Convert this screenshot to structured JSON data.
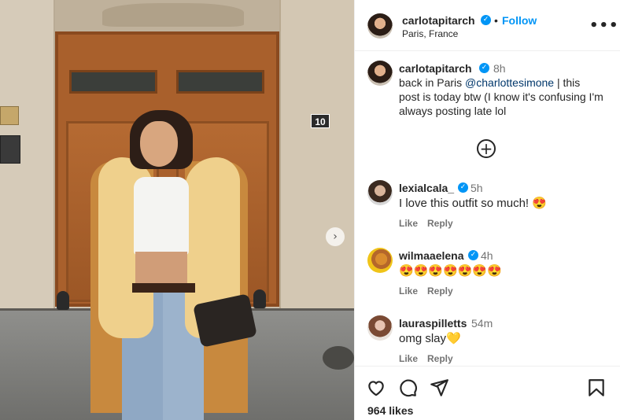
{
  "post": {
    "username": "carlotapitarch",
    "follow_label": "Follow",
    "separator": "•",
    "location": "Paris, France",
    "more_label": "•••",
    "house_number": "10",
    "next_glyph": "›"
  },
  "caption": {
    "username": "carlotapitarch",
    "time": "8h",
    "text_before": "back in Paris ",
    "mention": "@charlottesimone",
    "text_after": " | this post is today btw (I know it's confusing I'm always posting late lol"
  },
  "load_more_glyph": "+",
  "comments": [
    {
      "username": "lexialcala_",
      "verified": true,
      "time": "5h",
      "text": "I love this outfit so much! 😍",
      "like_label": "Like",
      "reply_label": "Reply"
    },
    {
      "username": "wilmaaelena",
      "verified": true,
      "time": "4h",
      "text": "😍😍😍😍😍😍😍",
      "like_label": "Like",
      "reply_label": "Reply"
    },
    {
      "username": "lauraspilletts",
      "verified": false,
      "time": "54m",
      "text": "omg slay💛",
      "like_label": "Like",
      "reply_label": "Reply"
    }
  ],
  "likes": "964 likes",
  "icons": {
    "heart": "heart-icon",
    "comment": "comment-icon",
    "share": "share-icon",
    "save": "bookmark-icon",
    "verified": "verified-badge-icon"
  },
  "colors": {
    "accent": "#0095f6",
    "mention": "#00376b",
    "muted": "#737373"
  }
}
